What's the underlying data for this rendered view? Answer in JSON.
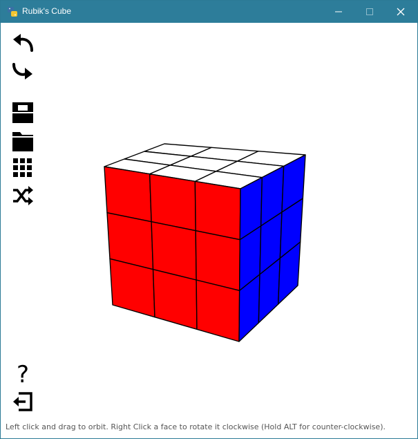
{
  "window": {
    "title": "Rubik's Cube",
    "titlebar_color": "#2d7d9a"
  },
  "toolbar": {
    "items": [
      {
        "name": "undo",
        "icon": "undo-arrow-icon"
      },
      {
        "name": "redo",
        "icon": "redo-arrow-icon"
      },
      {
        "name": "save",
        "icon": "save-box-icon"
      },
      {
        "name": "open",
        "icon": "folder-icon"
      },
      {
        "name": "grid",
        "icon": "grid-3x3-icon"
      },
      {
        "name": "shuffle",
        "icon": "shuffle-icon"
      },
      {
        "name": "help",
        "icon": "question-mark-icon",
        "label": "?"
      },
      {
        "name": "exit",
        "icon": "exit-icon"
      }
    ]
  },
  "cube": {
    "faces_visible": [
      "top",
      "front",
      "right"
    ],
    "colors": {
      "top": "#ffffff",
      "front": "#ff0000",
      "right": "#0000ff",
      "edge": "#000000"
    }
  },
  "status": {
    "text": "Left click and drag to orbit. Right Click a face to rotate it clockwise (Hold ALT for counter-clockwise)."
  }
}
